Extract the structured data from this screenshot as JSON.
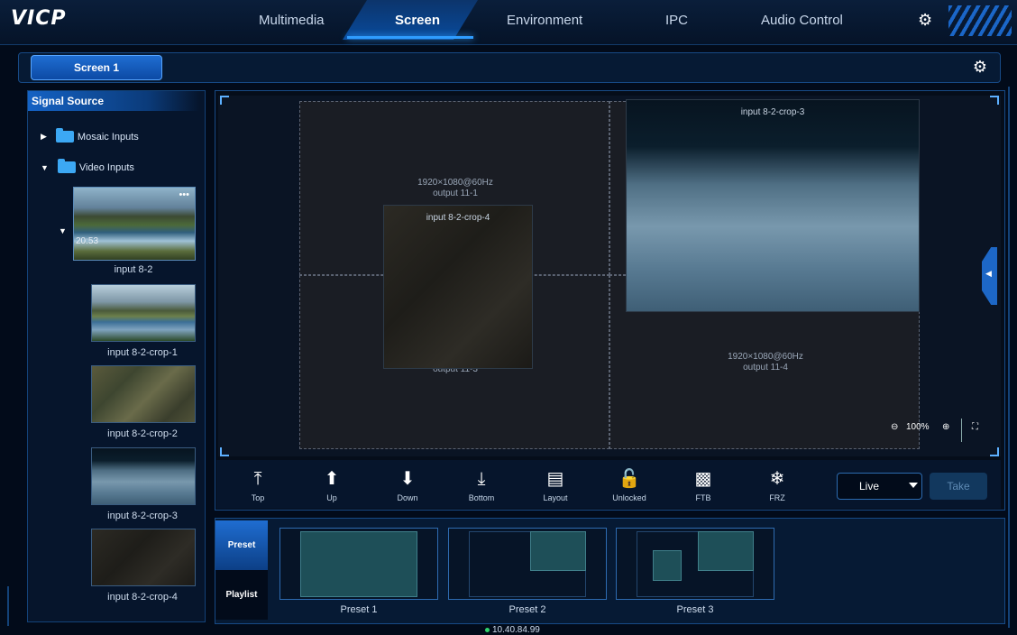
{
  "app": {
    "logo": "VICP"
  },
  "nav": {
    "tabs": [
      "Multimedia",
      "Screen",
      "Environment",
      "IPC",
      "Audio Control"
    ],
    "active": "Screen"
  },
  "screen_tabs": {
    "active_label": "Screen 1"
  },
  "signal_source": {
    "title": "Signal Source",
    "mosaic_label": "Mosaic Inputs",
    "video_label": "Video Inputs",
    "main_input": {
      "label": "input 8-2",
      "time": "20:53",
      "more": "•••"
    },
    "crops": [
      "input 8-2-crop-1",
      "input 8-2-crop-2",
      "input 8-2-crop-3",
      "input 8-2-crop-4"
    ]
  },
  "canvas": {
    "outputs": [
      {
        "res": "1920×1080@60Hz",
        "name": "output 11-1"
      },
      {
        "res": "",
        "name": "output 11-3"
      },
      {
        "res": "1920×1080@60Hz",
        "name": "output 11-4"
      }
    ],
    "windows": {
      "crop3": "input 8-2-crop-3",
      "crop4": "input 8-2-crop-4"
    },
    "zoom": "100%"
  },
  "toolbar": {
    "top": "Top",
    "up": "Up",
    "down": "Down",
    "bottom": "Bottom",
    "layout": "Layout",
    "unlocked": "Unlocked",
    "ftb": "FTB",
    "frz": "FRZ",
    "mode": "Live",
    "take": "Take"
  },
  "presets": {
    "tab_preset": "Preset",
    "tab_playlist": "Playlist",
    "items": [
      "Preset 1",
      "Preset 2",
      "Preset 3"
    ]
  },
  "status": {
    "ip": "10.40.84.99"
  },
  "colors": {
    "accent": "#1f6dd1",
    "background": "#020b1a",
    "status_ok": "#2fd36b"
  }
}
